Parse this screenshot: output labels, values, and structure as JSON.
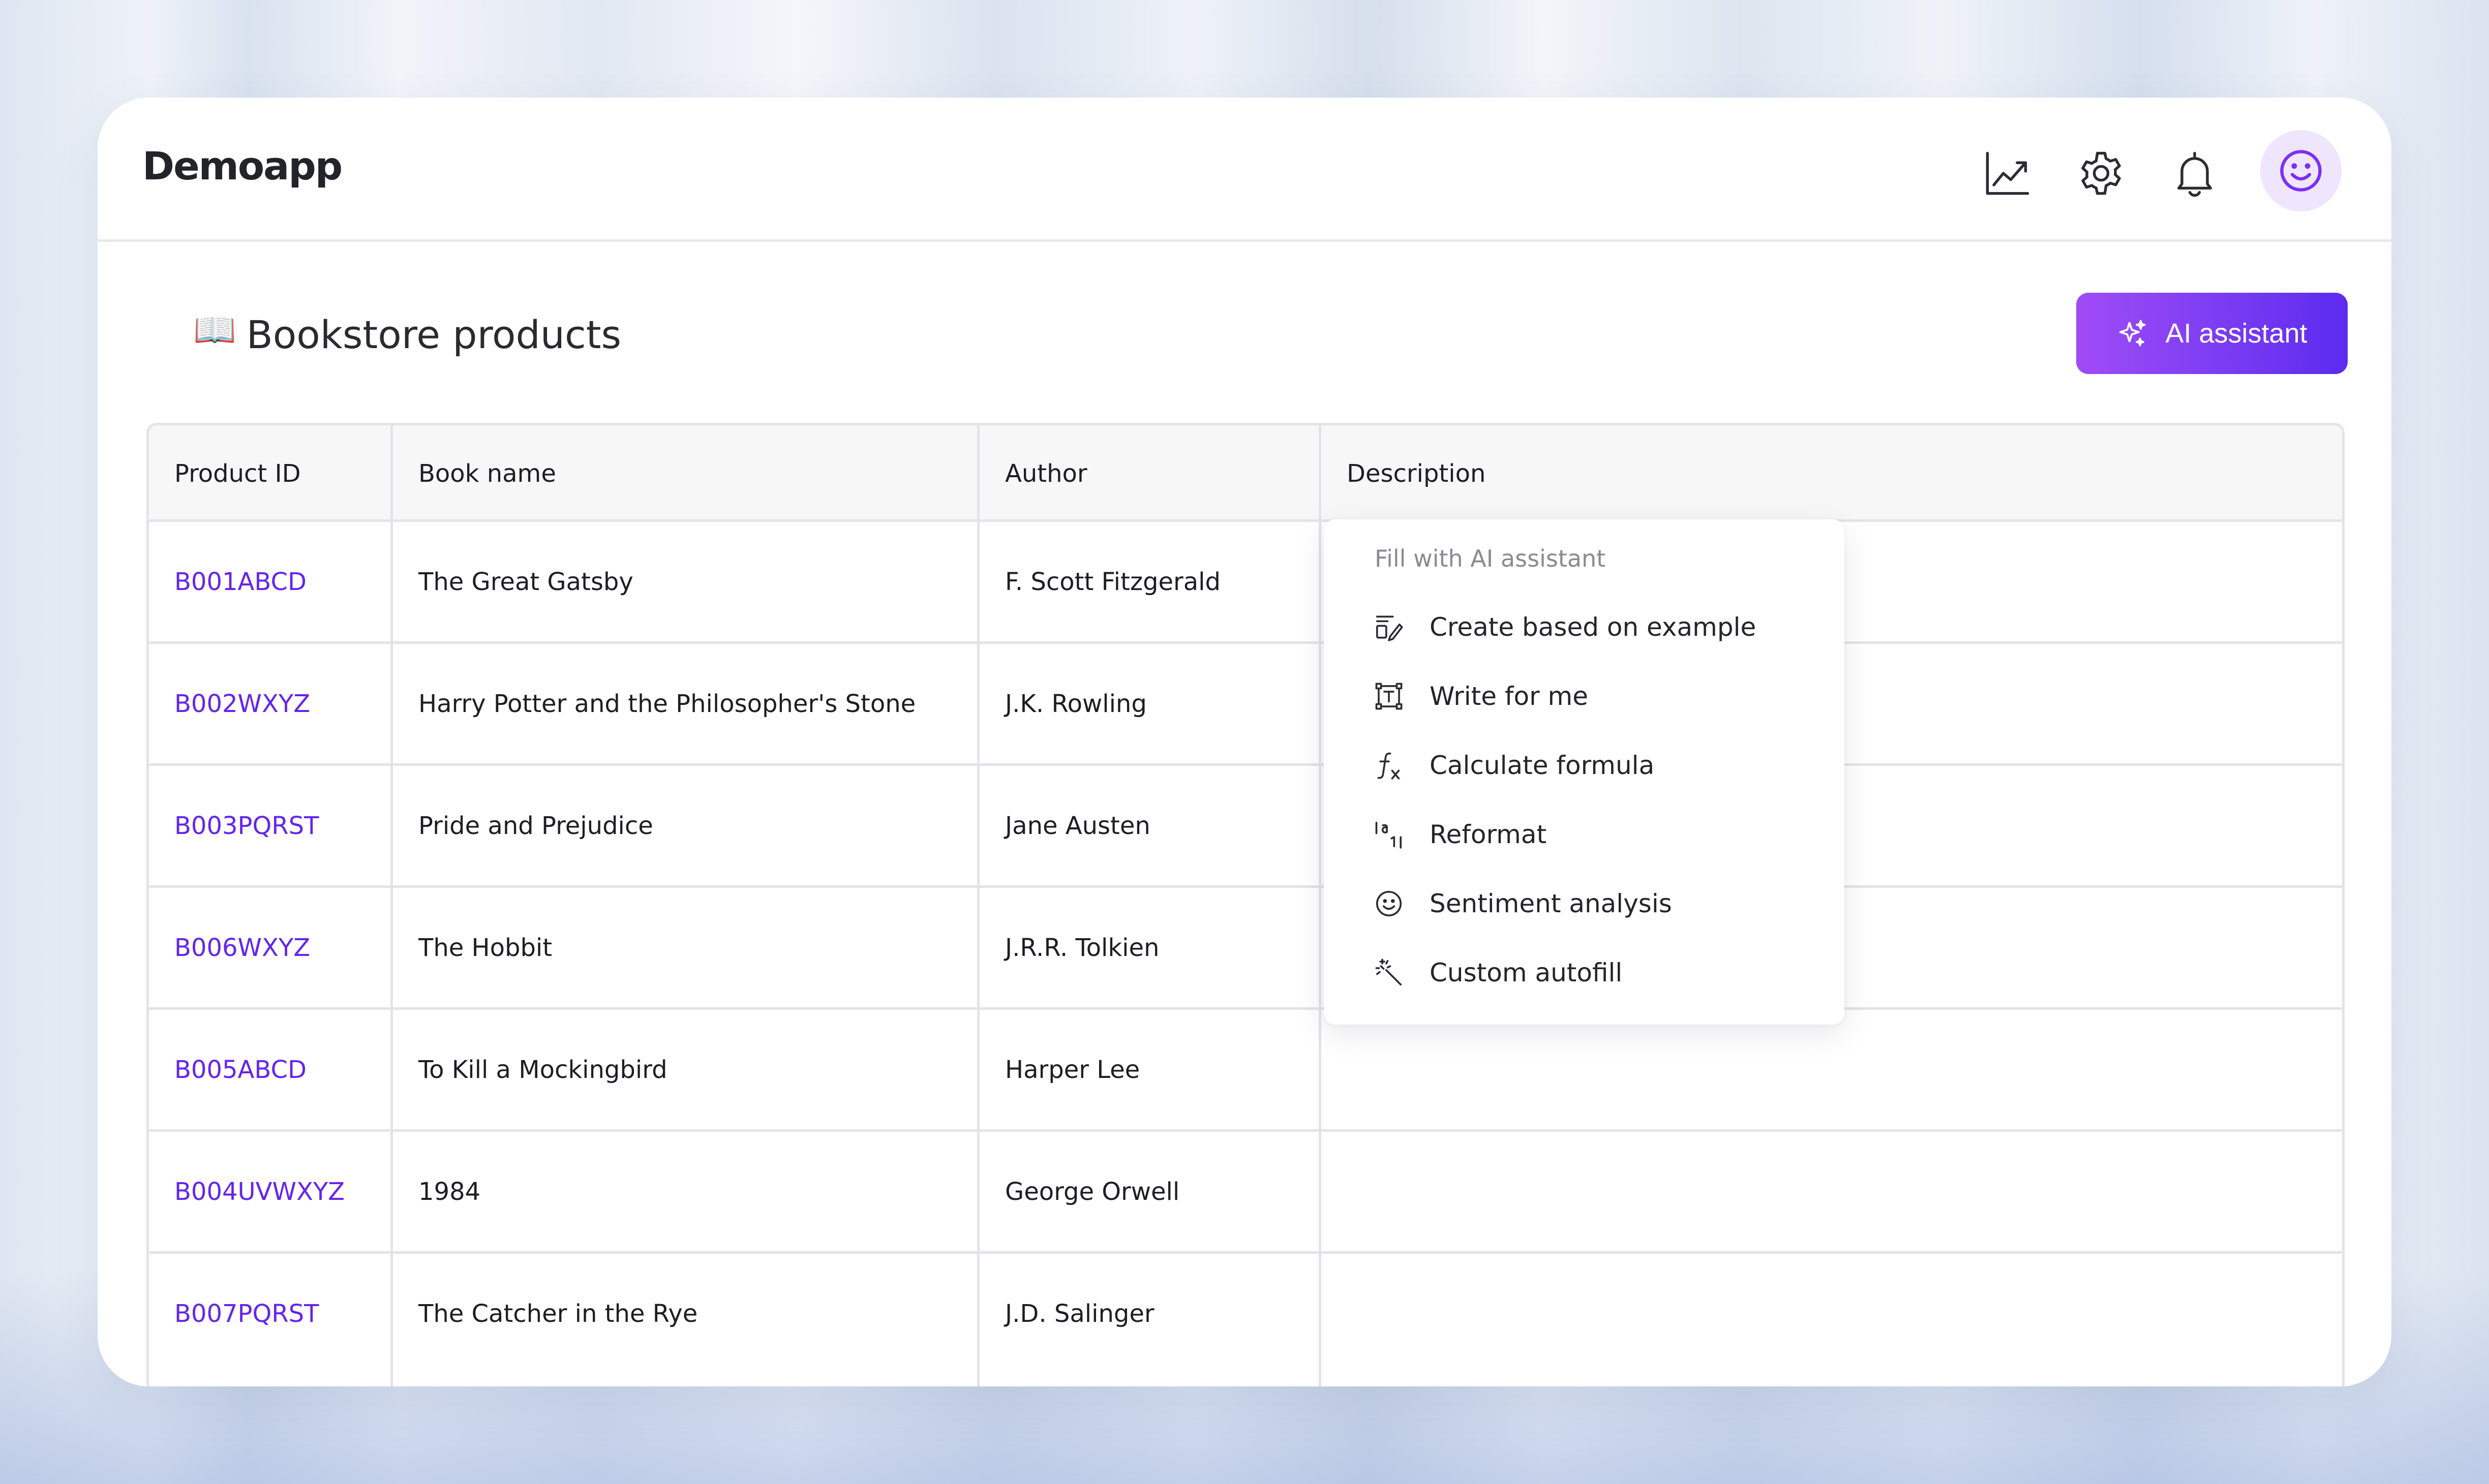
{
  "app": {
    "logo": "Demoapp"
  },
  "header": {
    "icons": [
      "chart-icon",
      "gear-icon",
      "bell-icon",
      "smiley-avatar-icon"
    ]
  },
  "page": {
    "emoji": "📖",
    "title": "Bookstore products"
  },
  "ai_button": {
    "label": "AI assistant",
    "icon": "sparkles-icon"
  },
  "table": {
    "columns": [
      "Product ID",
      "Book name",
      "Author",
      "Description"
    ],
    "rows": [
      {
        "id": "B001ABCD",
        "book": "The Great Gatsby",
        "author": "F. Scott Fitzgerald",
        "description": ""
      },
      {
        "id": "B002WXYZ",
        "book": "Harry Potter and the Philosopher's Stone",
        "author": "J.K. Rowling",
        "description": ""
      },
      {
        "id": "B003PQRST",
        "book": "Pride and Prejudice",
        "author": "Jane Austen",
        "description": ""
      },
      {
        "id": "B006WXYZ",
        "book": "The Hobbit",
        "author": "J.R.R. Tolkien",
        "description": ""
      },
      {
        "id": "B005ABCD",
        "book": "To Kill a Mockingbird",
        "author": "Harper Lee",
        "description": ""
      },
      {
        "id": "B004UVWXYZ",
        "book": "1984",
        "author": "George Orwell",
        "description": ""
      },
      {
        "id": "B007PQRST",
        "book": "The Catcher in the Rye",
        "author": "J.D. Salinger",
        "description": ""
      }
    ]
  },
  "dropdown": {
    "title": "Fill with AI assistant",
    "items": [
      {
        "label": "Create based on example",
        "icon": "edit-example-icon"
      },
      {
        "label": "Write for me",
        "icon": "text-frame-icon"
      },
      {
        "label": "Calculate formula",
        "icon": "function-icon"
      },
      {
        "label": "Reformat",
        "icon": "reformat-icon"
      },
      {
        "label": "Sentiment analysis",
        "icon": "smiley-icon"
      },
      {
        "label": "Custom autofill",
        "icon": "magic-wand-icon"
      }
    ]
  },
  "colors": {
    "accent": "#6424ee",
    "button_gradient_start": "#a04cf6",
    "button_gradient_end": "#5b2bef",
    "avatar_bg": "#efe5fd"
  }
}
